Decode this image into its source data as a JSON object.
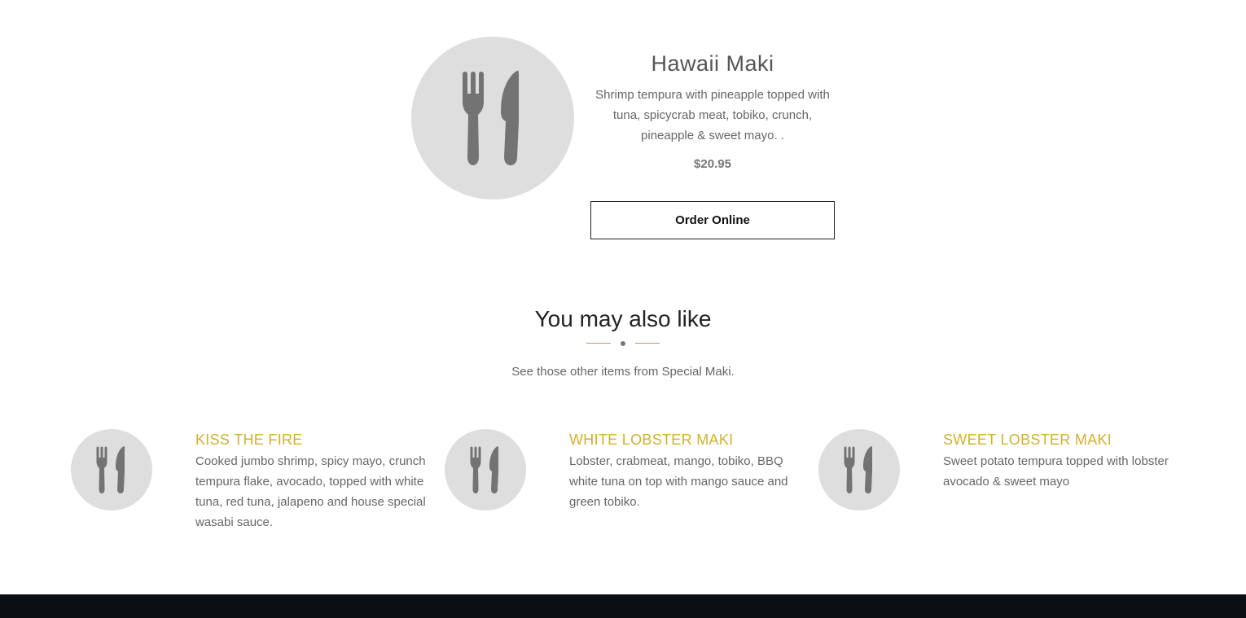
{
  "main_item": {
    "icon": "fork-knife-icon",
    "title": "Hawaii Maki",
    "description": "Shrimp tempura with pineapple topped with tuna, spicycrab meat, tobiko, crunch, pineapple & sweet mayo. .",
    "price": "$20.95",
    "order_label": "Order Online"
  },
  "related": {
    "title": "You may also like",
    "subtitle": "See those other items from Special Maki.",
    "items": [
      {
        "icon": "fork-knife-icon",
        "title": "KISS THE FIRE",
        "description": "Cooked jumbo shrimp, spicy mayo, crunch tempura flake, avocado, topped with white tuna, red tuna, jalapeno and house special wasabi sauce."
      },
      {
        "icon": "fork-knife-icon",
        "title": "WHITE LOBSTER MAKI",
        "description": "Lobster, crabmeat, mango, tobiko, BBQ white tuna on top with mango sauce and green tobiko."
      },
      {
        "icon": "fork-knife-icon",
        "title": "SWEET LOBSTER MAKI",
        "description": "Sweet potato tempura topped with lobster avocado & sweet mayo"
      }
    ]
  },
  "colors": {
    "accent": "#d4b12a",
    "photo_bg": "#dedede",
    "icon": "#737373",
    "footer": "#0b0e12"
  }
}
